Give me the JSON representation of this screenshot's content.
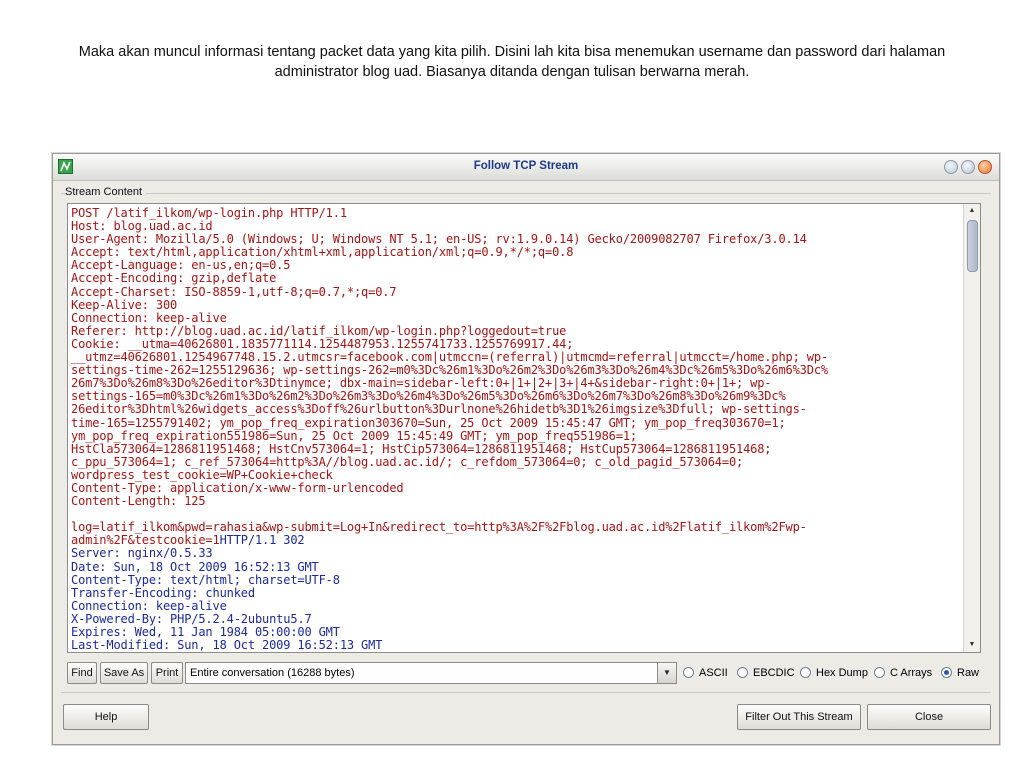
{
  "caption": "Maka akan muncul informasi tentang packet data yang kita pilih. Disini lah kita bisa menemukan username dan password dari halaman administrator blog uad. Biasanya ditanda dengan tulisan berwarna merah.",
  "window": {
    "title": "Follow TCP Stream",
    "stream_label": "Stream Content"
  },
  "colors": {
    "client": "#a41515",
    "server": "#1b2a9c"
  },
  "stream": {
    "lines": [
      {
        "text": "POST /latif_ilkom/wp-login.php HTTP/1.1",
        "dir": "client"
      },
      {
        "text": "Host: blog.uad.ac.id",
        "dir": "client"
      },
      {
        "text": "User-Agent: Mozilla/5.0 (Windows; U; Windows NT 5.1; en-US; rv:1.9.0.14) Gecko/2009082707 Firefox/3.0.14",
        "dir": "client"
      },
      {
        "text": "Accept: text/html,application/xhtml+xml,application/xml;q=0.9,*/*;q=0.8",
        "dir": "client"
      },
      {
        "text": "Accept-Language: en-us,en;q=0.5",
        "dir": "client"
      },
      {
        "text": "Accept-Encoding: gzip,deflate",
        "dir": "client"
      },
      {
        "text": "Accept-Charset: ISO-8859-1,utf-8;q=0.7,*;q=0.7",
        "dir": "client"
      },
      {
        "text": "Keep-Alive: 300",
        "dir": "client"
      },
      {
        "text": "Connection: keep-alive",
        "dir": "client"
      },
      {
        "text": "Referer: http://blog.uad.ac.id/latif_ilkom/wp-login.php?loggedout=true",
        "dir": "client"
      },
      {
        "text": "Cookie: __utma=40626801.1835771114.1254487953.1255741733.1255769917.44;",
        "dir": "client"
      },
      {
        "text": "__utmz=40626801.1254967748.15.2.utmcsr=facebook.com|utmccn=(referral)|utmcmd=referral|utmcct=/home.php; wp-",
        "dir": "client"
      },
      {
        "text": "settings-time-262=1255129636; wp-settings-262=m0%3Dc%26m1%3Do%26m2%3Do%26m3%3Do%26m4%3Dc%26m5%3Do%26m6%3Dc%",
        "dir": "client"
      },
      {
        "text": "26m7%3Do%26m8%3Do%26editor%3Dtinymce; dbx-main=sidebar-left:0+|1+|2+|3+|4+&sidebar-right:0+|1+; wp-",
        "dir": "client"
      },
      {
        "text": "settings-165=m0%3Dc%26m1%3Do%26m2%3Do%26m3%3Do%26m4%3Do%26m5%3Do%26m6%3Do%26m7%3Do%26m8%3Do%26m9%3Dc%",
        "dir": "client"
      },
      {
        "text": "26editor%3Dhtml%26widgets_access%3Doff%26urlbutton%3Durlnone%26hidetb%3D1%26imgsize%3Dfull; wp-settings-",
        "dir": "client"
      },
      {
        "text": "time-165=1255791402; ym_pop_freq_expiration303670=Sun, 25 Oct 2009 15:45:47 GMT; ym_pop_freq303670=1;",
        "dir": "client"
      },
      {
        "text": "ym_pop_freq_expiration551986=Sun, 25 Oct 2009 15:45:49 GMT; ym_pop_freq551986=1;",
        "dir": "client"
      },
      {
        "text": "HstCla573064=1286811951468; HstCnv573064=1; HstCip573064=1286811951468; HstCup573064=1286811951468;",
        "dir": "client"
      },
      {
        "text": "c_ppu_573064=1; c_ref_573064=http%3A//blog.uad.ac.id/; c_refdom_573064=0; c_old_pagid_573064=0;",
        "dir": "client"
      },
      {
        "text": "wordpress_test_cookie=WP+Cookie+check",
        "dir": "client"
      },
      {
        "text": "Content-Type: application/x-www-form-urlencoded",
        "dir": "client"
      },
      {
        "text": "Content-Length: 125",
        "dir": "client"
      },
      {
        "text": " ",
        "dir": "client"
      },
      {
        "text": "log=latif_ilkom&pwd=rahasia&wp-submit=Log+In&redirect_to=http%3A%2F%2Fblog.uad.ac.id%2Flatif_ilkom%2Fwp-",
        "dir": "client"
      },
      {
        "text": "admin%2F&testcookie=1",
        "dir": "client",
        "tail": "HTTP/1.1 302",
        "tail_dir": "server"
      },
      {
        "text": "Server: nginx/0.5.33",
        "dir": "server"
      },
      {
        "text": "Date: Sun, 18 Oct 2009 16:52:13 GMT",
        "dir": "server"
      },
      {
        "text": "Content-Type: text/html; charset=UTF-8",
        "dir": "server"
      },
      {
        "text": "Transfer-Encoding: chunked",
        "dir": "server"
      },
      {
        "text": "Connection: keep-alive",
        "dir": "server"
      },
      {
        "text": "X-Powered-By: PHP/5.2.4-2ubuntu5.7",
        "dir": "server"
      },
      {
        "text": "Expires: Wed, 11 Jan 1984 05:00:00 GMT",
        "dir": "server"
      },
      {
        "text": "Last-Modified: Sun, 18 Oct 2009 16:52:13 GMT",
        "dir": "server"
      }
    ]
  },
  "controls": {
    "find": "Find",
    "save_as": "Save As",
    "print": "Print",
    "conversation": "Entire conversation (16288 bytes)",
    "modes": [
      {
        "label": "ASCII",
        "selected": false
      },
      {
        "label": "EBCDIC",
        "selected": false
      },
      {
        "label": "Hex Dump",
        "selected": false
      },
      {
        "label": "C Arrays",
        "selected": false
      },
      {
        "label": "Raw",
        "selected": true
      }
    ]
  },
  "footer": {
    "help": "Help",
    "filter_out": "Filter Out This Stream",
    "close": "Close"
  }
}
